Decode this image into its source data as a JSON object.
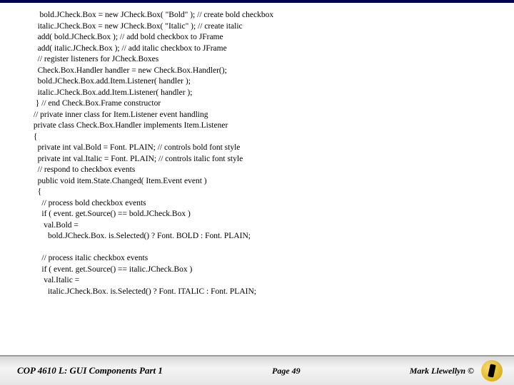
{
  "code": {
    "l1": "    bold.JCheck.Box = new JCheck.Box( \"Bold\" ); // create bold checkbox",
    "l2": "   italic.JCheck.Box = new JCheck.Box( \"Italic\" ); // create italic",
    "l3": "   add( bold.JCheck.Box ); // add bold checkbox to JFrame",
    "l4": "   add( italic.JCheck.Box ); // add italic checkbox to JFrame",
    "l5": "   // register listeners for JCheck.Boxes",
    "l6": "   Check.Box.Handler handler = new Check.Box.Handler();",
    "l7": "   bold.JCheck.Box.add.Item.Listener( handler );",
    "l8": "   italic.JCheck.Box.add.Item.Listener( handler );",
    "l9": "  } // end Check.Box.Frame constructor",
    "l10": " // private inner class for Item.Listener event handling",
    "l11": " private class Check.Box.Handler implements Item.Listener",
    "l12": " {",
    "l13": "   private int val.Bold = Font. PLAIN; // controls bold font style",
    "l14": "   private int val.Italic = Font. PLAIN; // controls italic font style",
    "l15": "   // respond to checkbox events",
    "l16": "   public void item.State.Changed( Item.Event event )",
    "l17": "   {",
    "l18": "     // process bold checkbox events",
    "l19": "     if ( event. get.Source() == bold.JCheck.Box )",
    "l20": "      val.Bold =",
    "l21": "        bold.JCheck.Box. is.Selected() ? Font. BOLD : Font. PLAIN;",
    "l22": " ",
    "l23": "     // process italic checkbox events",
    "l24": "     if ( event. get.Source() == italic.JCheck.Box )",
    "l25": "      val.Italic =",
    "l26": "        italic.JCheck.Box. is.Selected() ? Font. ITALIC : Font. PLAIN;"
  },
  "footer": {
    "title": "COP 4610 L: GUI Components Part 1",
    "page": "Page 49",
    "author": "Mark Llewellyn ©"
  }
}
